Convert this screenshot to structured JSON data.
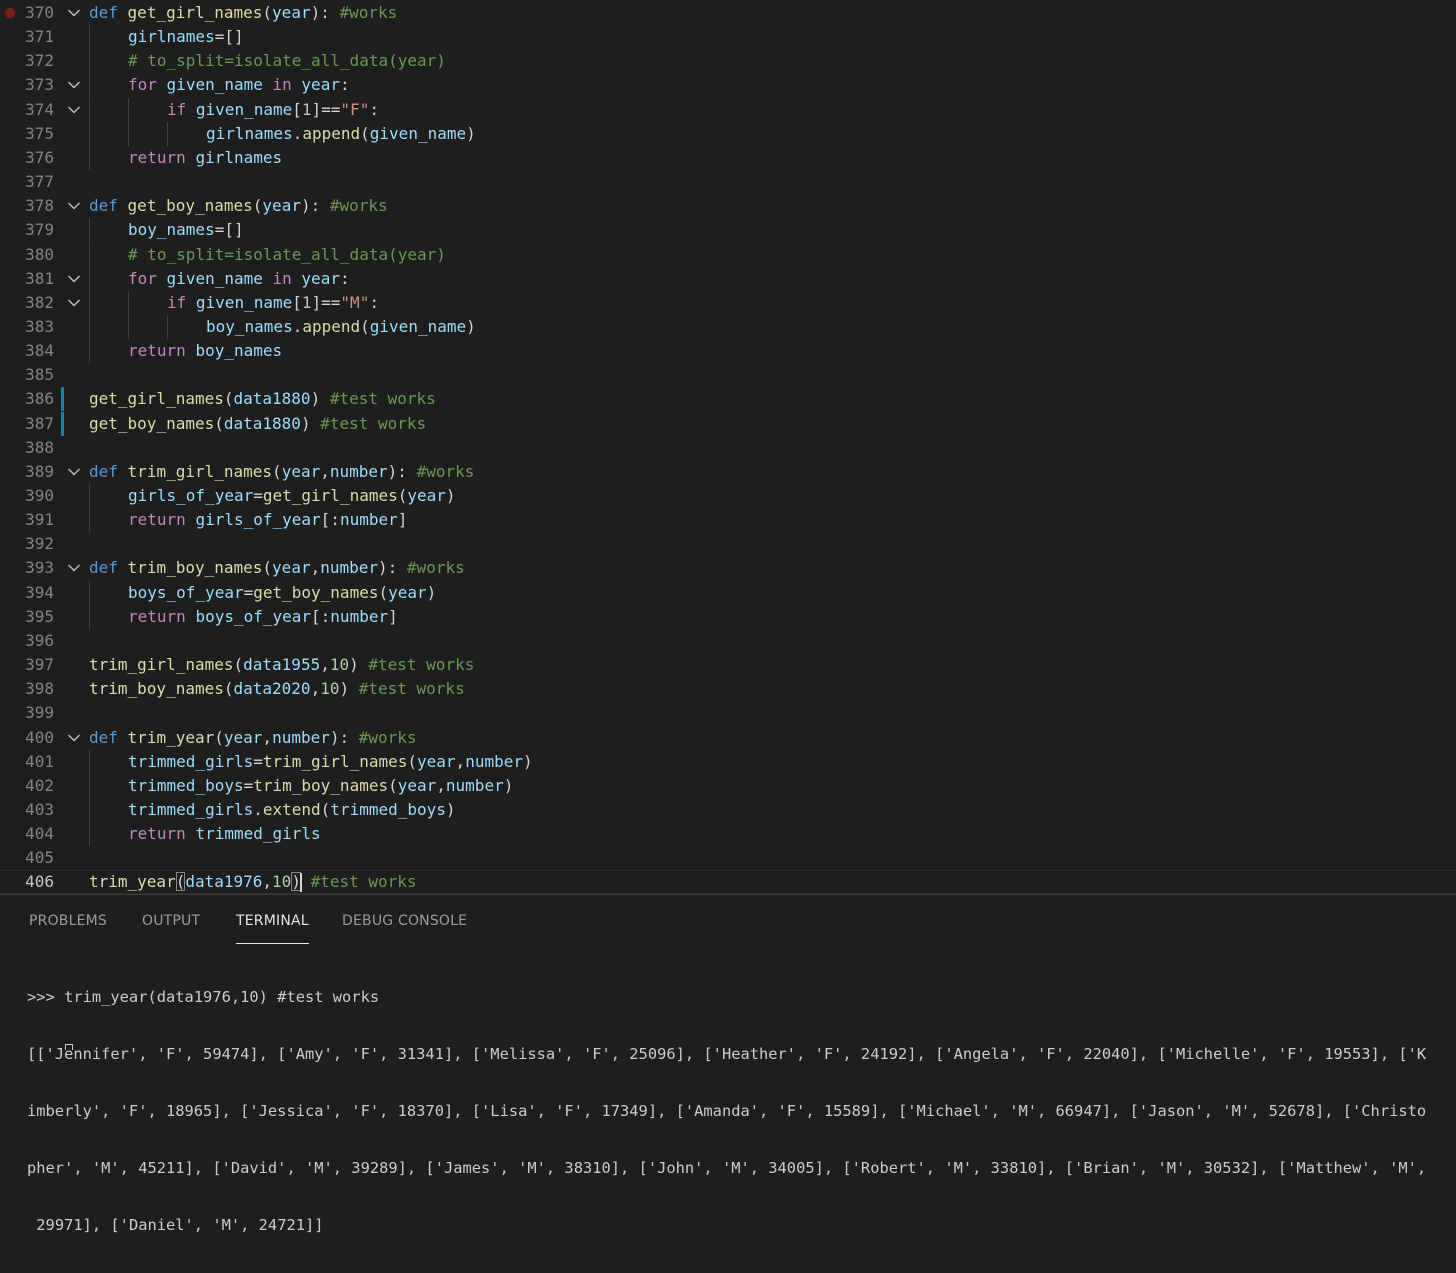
{
  "editor": {
    "lines": [
      {
        "n": "370",
        "fold": true,
        "breakpoint": true,
        "tokens": [
          [
            "kw",
            "def"
          ],
          [
            "pn",
            " "
          ],
          [
            "fn",
            "get_girl_names"
          ],
          [
            "pn",
            "("
          ],
          [
            "vr",
            "year"
          ],
          [
            "pn",
            "): "
          ],
          [
            "cm",
            "#works"
          ]
        ]
      },
      {
        "n": "371",
        "indent": 1,
        "tokens": [
          [
            "vr",
            "girlnames"
          ],
          [
            "pn",
            "=[]"
          ]
        ]
      },
      {
        "n": "372",
        "indent": 1,
        "tokens": [
          [
            "cm",
            "# to_split=isolate_all_data(year)"
          ]
        ]
      },
      {
        "n": "373",
        "fold": true,
        "indent": 1,
        "tokens": [
          [
            "ctl",
            "for"
          ],
          [
            "pn",
            " "
          ],
          [
            "vr",
            "given_name"
          ],
          [
            "pn",
            " "
          ],
          [
            "ctl",
            "in"
          ],
          [
            "pn",
            " "
          ],
          [
            "vr",
            "year"
          ],
          [
            "pn",
            ":"
          ]
        ]
      },
      {
        "n": "374",
        "fold": true,
        "indent": 2,
        "tokens": [
          [
            "ctl",
            "if"
          ],
          [
            "pn",
            " "
          ],
          [
            "vr",
            "given_name"
          ],
          [
            "pn",
            "["
          ],
          [
            "nm",
            "1"
          ],
          [
            "pn",
            "]=="
          ],
          [
            "st",
            "\"F\""
          ],
          [
            "pn",
            ":"
          ]
        ]
      },
      {
        "n": "375",
        "indent": 3,
        "tokens": [
          [
            "vr",
            "girlnames"
          ],
          [
            "pn",
            "."
          ],
          [
            "fn",
            "append"
          ],
          [
            "pn",
            "("
          ],
          [
            "vr",
            "given_name"
          ],
          [
            "pn",
            ")"
          ]
        ]
      },
      {
        "n": "376",
        "indent": 1,
        "tokens": [
          [
            "ctl",
            "return"
          ],
          [
            "pn",
            " "
          ],
          [
            "vr",
            "girlnames"
          ]
        ]
      },
      {
        "n": "377",
        "tokens": []
      },
      {
        "n": "378",
        "fold": true,
        "tokens": [
          [
            "kw",
            "def"
          ],
          [
            "pn",
            " "
          ],
          [
            "fn",
            "get_boy_names"
          ],
          [
            "pn",
            "("
          ],
          [
            "vr",
            "year"
          ],
          [
            "pn",
            "): "
          ],
          [
            "cm",
            "#works"
          ]
        ]
      },
      {
        "n": "379",
        "indent": 1,
        "tokens": [
          [
            "vr",
            "boy_names"
          ],
          [
            "pn",
            "=[]"
          ]
        ]
      },
      {
        "n": "380",
        "indent": 1,
        "tokens": [
          [
            "cm",
            "# to_split=isolate_all_data(year)"
          ]
        ]
      },
      {
        "n": "381",
        "fold": true,
        "indent": 1,
        "tokens": [
          [
            "ctl",
            "for"
          ],
          [
            "pn",
            " "
          ],
          [
            "vr",
            "given_name"
          ],
          [
            "pn",
            " "
          ],
          [
            "ctl",
            "in"
          ],
          [
            "pn",
            " "
          ],
          [
            "vr",
            "year"
          ],
          [
            "pn",
            ":"
          ]
        ]
      },
      {
        "n": "382",
        "fold": true,
        "indent": 2,
        "tokens": [
          [
            "ctl",
            "if"
          ],
          [
            "pn",
            " "
          ],
          [
            "vr",
            "given_name"
          ],
          [
            "pn",
            "["
          ],
          [
            "nm",
            "1"
          ],
          [
            "pn",
            "]=="
          ],
          [
            "st",
            "\"M\""
          ],
          [
            "pn",
            ":"
          ]
        ]
      },
      {
        "n": "383",
        "indent": 3,
        "tokens": [
          [
            "vr",
            "boy_names"
          ],
          [
            "pn",
            "."
          ],
          [
            "fn",
            "append"
          ],
          [
            "pn",
            "("
          ],
          [
            "vr",
            "given_name"
          ],
          [
            "pn",
            ")"
          ]
        ]
      },
      {
        "n": "384",
        "indent": 1,
        "tokens": [
          [
            "ctl",
            "return"
          ],
          [
            "pn",
            " "
          ],
          [
            "vr",
            "boy_names"
          ]
        ]
      },
      {
        "n": "385",
        "tokens": []
      },
      {
        "n": "386",
        "git": true,
        "tokens": [
          [
            "fn",
            "get_girl_names"
          ],
          [
            "pn",
            "("
          ],
          [
            "vr",
            "data1880"
          ],
          [
            "pn",
            ") "
          ],
          [
            "cm",
            "#test works"
          ]
        ]
      },
      {
        "n": "387",
        "git": true,
        "tokens": [
          [
            "fn",
            "get_boy_names"
          ],
          [
            "pn",
            "("
          ],
          [
            "vr",
            "data1880"
          ],
          [
            "pn",
            ") "
          ],
          [
            "cm",
            "#test works"
          ]
        ]
      },
      {
        "n": "388",
        "tokens": []
      },
      {
        "n": "389",
        "fold": true,
        "tokens": [
          [
            "kw",
            "def"
          ],
          [
            "pn",
            " "
          ],
          [
            "fn",
            "trim_girl_names"
          ],
          [
            "pn",
            "("
          ],
          [
            "vr",
            "year"
          ],
          [
            "pn",
            ","
          ],
          [
            "vr",
            "number"
          ],
          [
            "pn",
            "): "
          ],
          [
            "cm",
            "#works"
          ]
        ]
      },
      {
        "n": "390",
        "indent": 1,
        "tokens": [
          [
            "vr",
            "girls_of_year"
          ],
          [
            "pn",
            "="
          ],
          [
            "fn",
            "get_girl_names"
          ],
          [
            "pn",
            "("
          ],
          [
            "vr",
            "year"
          ],
          [
            "pn",
            ")"
          ]
        ]
      },
      {
        "n": "391",
        "indent": 1,
        "tokens": [
          [
            "ctl",
            "return"
          ],
          [
            "pn",
            " "
          ],
          [
            "vr",
            "girls_of_year"
          ],
          [
            "pn",
            "[:"
          ],
          [
            "vr",
            "number"
          ],
          [
            "pn",
            "]"
          ]
        ]
      },
      {
        "n": "392",
        "tokens": []
      },
      {
        "n": "393",
        "fold": true,
        "tokens": [
          [
            "kw",
            "def"
          ],
          [
            "pn",
            " "
          ],
          [
            "fn",
            "trim_boy_names"
          ],
          [
            "pn",
            "("
          ],
          [
            "vr",
            "year"
          ],
          [
            "pn",
            ","
          ],
          [
            "vr",
            "number"
          ],
          [
            "pn",
            "): "
          ],
          [
            "cm",
            "#works"
          ]
        ]
      },
      {
        "n": "394",
        "indent": 1,
        "tokens": [
          [
            "vr",
            "boys_of_year"
          ],
          [
            "pn",
            "="
          ],
          [
            "fn",
            "get_boy_names"
          ],
          [
            "pn",
            "("
          ],
          [
            "vr",
            "year"
          ],
          [
            "pn",
            ")"
          ]
        ]
      },
      {
        "n": "395",
        "indent": 1,
        "tokens": [
          [
            "ctl",
            "return"
          ],
          [
            "pn",
            " "
          ],
          [
            "vr",
            "boys_of_year"
          ],
          [
            "pn",
            "[:"
          ],
          [
            "vr",
            "number"
          ],
          [
            "pn",
            "]"
          ]
        ]
      },
      {
        "n": "396",
        "tokens": []
      },
      {
        "n": "397",
        "tokens": [
          [
            "fn",
            "trim_girl_names"
          ],
          [
            "pn",
            "("
          ],
          [
            "vr",
            "data1955"
          ],
          [
            "pn",
            ","
          ],
          [
            "nm",
            "10"
          ],
          [
            "pn",
            ") "
          ],
          [
            "cm",
            "#test works"
          ]
        ]
      },
      {
        "n": "398",
        "tokens": [
          [
            "fn",
            "trim_boy_names"
          ],
          [
            "pn",
            "("
          ],
          [
            "vr",
            "data2020"
          ],
          [
            "pn",
            ","
          ],
          [
            "nm",
            "10"
          ],
          [
            "pn",
            ") "
          ],
          [
            "cm",
            "#test works"
          ]
        ]
      },
      {
        "n": "399",
        "tokens": []
      },
      {
        "n": "400",
        "fold": true,
        "tokens": [
          [
            "kw",
            "def"
          ],
          [
            "pn",
            " "
          ],
          [
            "fn",
            "trim_year"
          ],
          [
            "pn",
            "("
          ],
          [
            "vr",
            "year"
          ],
          [
            "pn",
            ","
          ],
          [
            "vr",
            "number"
          ],
          [
            "pn",
            "): "
          ],
          [
            "cm",
            "#works"
          ]
        ]
      },
      {
        "n": "401",
        "indent": 1,
        "tokens": [
          [
            "vr",
            "trimmed_girls"
          ],
          [
            "pn",
            "="
          ],
          [
            "fn",
            "trim_girl_names"
          ],
          [
            "pn",
            "("
          ],
          [
            "vr",
            "year"
          ],
          [
            "pn",
            ","
          ],
          [
            "vr",
            "number"
          ],
          [
            "pn",
            ")"
          ]
        ]
      },
      {
        "n": "402",
        "indent": 1,
        "tokens": [
          [
            "vr",
            "trimmed_boys"
          ],
          [
            "pn",
            "="
          ],
          [
            "fn",
            "trim_boy_names"
          ],
          [
            "pn",
            "("
          ],
          [
            "vr",
            "year"
          ],
          [
            "pn",
            ","
          ],
          [
            "vr",
            "number"
          ],
          [
            "pn",
            ")"
          ]
        ]
      },
      {
        "n": "403",
        "indent": 1,
        "tokens": [
          [
            "vr",
            "trimmed_girls"
          ],
          [
            "pn",
            "."
          ],
          [
            "fn",
            "extend"
          ],
          [
            "pn",
            "("
          ],
          [
            "vr",
            "trimmed_boys"
          ],
          [
            "pn",
            ")"
          ]
        ]
      },
      {
        "n": "404",
        "indent": 1,
        "tokens": [
          [
            "ctl",
            "return"
          ],
          [
            "pn",
            " "
          ],
          [
            "vr",
            "trimmed_girls"
          ]
        ]
      },
      {
        "n": "405",
        "tokens": []
      },
      {
        "n": "406",
        "current": true,
        "tokens": [
          [
            "fn",
            "trim_year"
          ],
          [
            "pnb",
            "("
          ],
          [
            "vr",
            "data1976"
          ],
          [
            "pn",
            ","
          ],
          [
            "nm",
            "10"
          ],
          [
            "pnc",
            ")"
          ],
          [
            "pn",
            " "
          ],
          [
            "cm",
            "#test works"
          ]
        ]
      }
    ]
  },
  "panel": {
    "tabs": [
      {
        "label": "PROBLEMS",
        "active": false,
        "name": "tab-problems"
      },
      {
        "label": "OUTPUT",
        "active": false,
        "name": "tab-output"
      },
      {
        "label": "TERMINAL",
        "active": true,
        "name": "tab-terminal"
      },
      {
        "label": "DEBUG CONSOLE",
        "active": false,
        "name": "tab-debug-console"
      }
    ],
    "terminal": {
      "command": ">>> trim_year(data1976,10) #test works",
      "output": [
        "[['Jennifer', 'F', 59474], ['Amy', 'F', 31341], ['Melissa', 'F', 25096], ['Heather', 'F', 24192], ['Angela', 'F', 22040], ['Michelle', 'F', 19553], ['K",
        "imberly', 'F', 18965], ['Jessica', 'F', 18370], ['Lisa', 'F', 17349], ['Amanda', 'F', 15589], ['Michael', 'M', 66947], ['Jason', 'M', 52678], ['Christo",
        "pher', 'M', 45211], ['David', 'M', 39289], ['James', 'M', 38310], ['John', 'M', 34005], ['Robert', 'M', 33810], ['Brian', 'M', 30532], ['Matthew', 'M',",
        " 29971], ['Daniel', 'M', 24721]]"
      ]
    }
  }
}
